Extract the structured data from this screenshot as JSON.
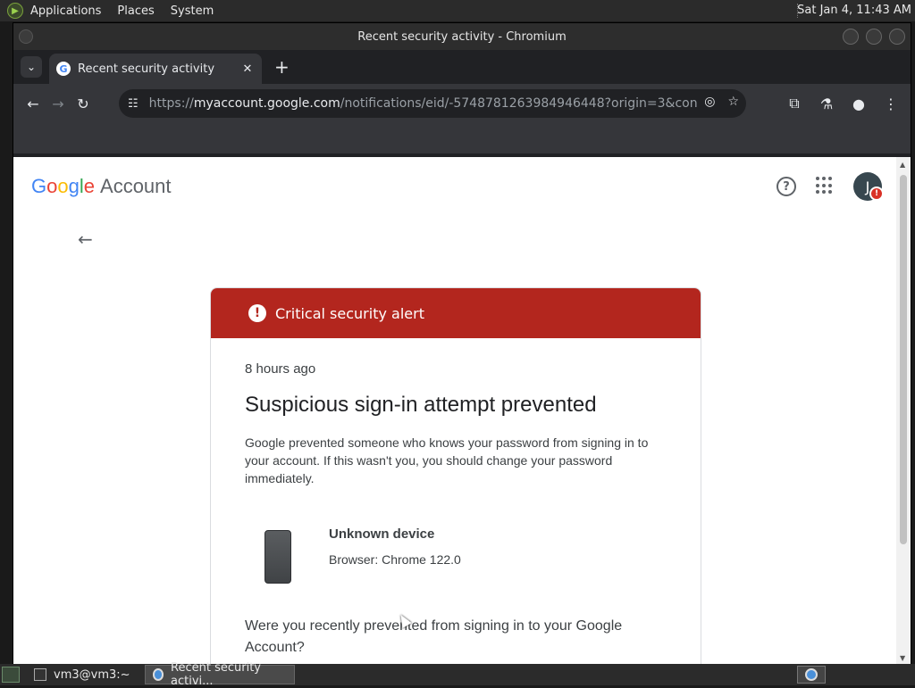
{
  "desktop": {
    "menus": [
      "Applications",
      "Places",
      "System"
    ],
    "clock": "Sat Jan  4, 11:43 AM"
  },
  "window": {
    "title": "Recent security activity - Chromium"
  },
  "browser": {
    "tab_title": "Recent security activity",
    "url_host": "myaccount.google.com",
    "url_prefix": "https://",
    "url_rest": "/notifications/eid/-5748781263984946448?origin=3&continue…"
  },
  "header": {
    "logo_letters": [
      "G",
      "o",
      "o",
      "g",
      "l",
      "e"
    ],
    "logo_suffix": "Account",
    "avatar_initial": "J",
    "avatar_badge": "!"
  },
  "alert": {
    "banner": "Critical security alert",
    "time_ago": "8 hours ago",
    "headline": "Suspicious sign-in attempt prevented",
    "description": "Google prevented someone who knows your password from signing in to your account. If this wasn't you, you should change your password immediately.",
    "device_name": "Unknown device",
    "device_browser": "Browser: Chrome 122.0",
    "question": "Were you recently prevented from signing in to your Google Account?"
  },
  "taskbar": {
    "tasks": [
      "vm3@vm3:~",
      "Recent security activi..."
    ]
  },
  "colors": {
    "alert_red": "#b3261e",
    "google_blue": "#4285f4"
  }
}
